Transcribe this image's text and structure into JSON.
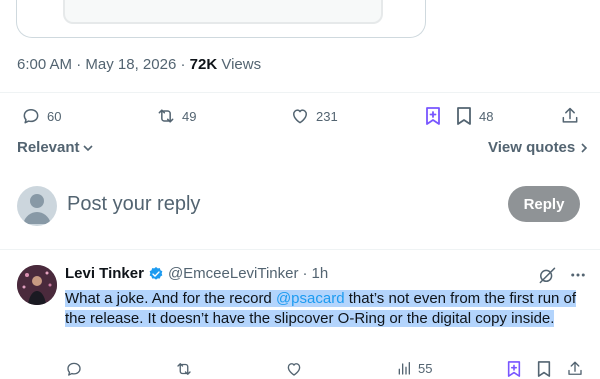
{
  "post": {
    "time": "6:00 AM",
    "sep1": "·",
    "date": "May 18, 2026",
    "sep2": "·",
    "views_count": "72K",
    "views_label": "Views"
  },
  "actions": {
    "replies": "60",
    "reposts": "49",
    "likes": "231",
    "bookmarks": "48"
  },
  "sort": {
    "label": "Relevant",
    "view_quotes": "View quotes"
  },
  "compose": {
    "placeholder": "Post your reply",
    "button": "Reply"
  },
  "reply": {
    "name": "Levi Tinker",
    "handle": "@EmceeLeviTinker",
    "sep": "·",
    "time": "1h",
    "text_before": "What a joke. And for the record ",
    "mention": "@psacard",
    "text_after": " that’s not even from the first run of the release. It doesn’t have the slipcover O-Ring or the digital copy inside.",
    "views": "55"
  },
  "colors": {
    "accent": "#1d9bf0",
    "verified": "#1d9bf0",
    "bookmark_special": "#7856ff",
    "muted": "#536471",
    "selection": "#b3d4fc"
  },
  "icons": [
    "reply-icon",
    "repost-icon",
    "like-icon",
    "grok-bookmark-icon",
    "bookmark-icon",
    "share-icon",
    "chevron-down-icon",
    "chevron-right-icon",
    "verified-badge-icon",
    "grok-icon",
    "more-icon",
    "views-icon"
  ]
}
